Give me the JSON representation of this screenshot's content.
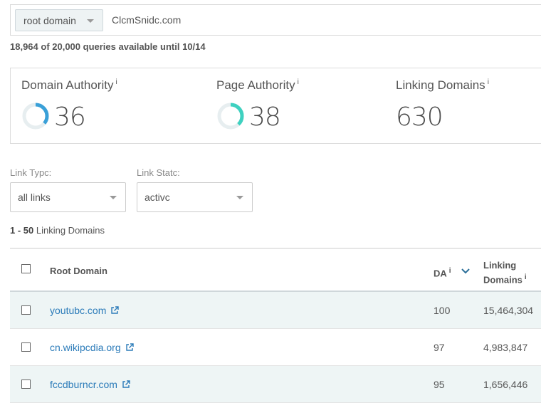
{
  "search": {
    "scope": "root domain",
    "domain": "ClcmSnidc.com"
  },
  "quota": "18,964 of 20,000 queries available until 10/14",
  "metrics": [
    {
      "label": "Domain Authority",
      "info": "i",
      "value": "36",
      "gauge": 36,
      "color": "#3aa0d8"
    },
    {
      "label": "Page Authority",
      "info": "i",
      "value": "38",
      "gauge": 38,
      "color": "#3ed1c0"
    },
    {
      "label": "Linking Domains",
      "info": "i",
      "value": "630"
    }
  ],
  "filters": {
    "link_type": {
      "label": "Link Typc:",
      "value": "all links"
    },
    "link_state": {
      "label": "Link Statc:",
      "value": "activc"
    }
  },
  "range": {
    "bold": "1 - 50",
    "text": "Linking Domains"
  },
  "table": {
    "headers": {
      "root_domain": "Root Domain",
      "da": "DA",
      "da_info": "i",
      "ld_line1": "Linking",
      "ld_line2": "Domains",
      "ld_info": "i"
    },
    "rows": [
      {
        "domain": "youtubc.com",
        "da": "100",
        "linking_domains": "15,464,304"
      },
      {
        "domain": "cn.wikipcdia.org",
        "da": "97",
        "linking_domains": "4,983,847"
      },
      {
        "domain": "fccdburncr.com",
        "da": "95",
        "linking_domains": "1,656,446"
      }
    ]
  },
  "colors": {
    "link": "#2b7bb9",
    "row_alt": "#eef5f5"
  }
}
